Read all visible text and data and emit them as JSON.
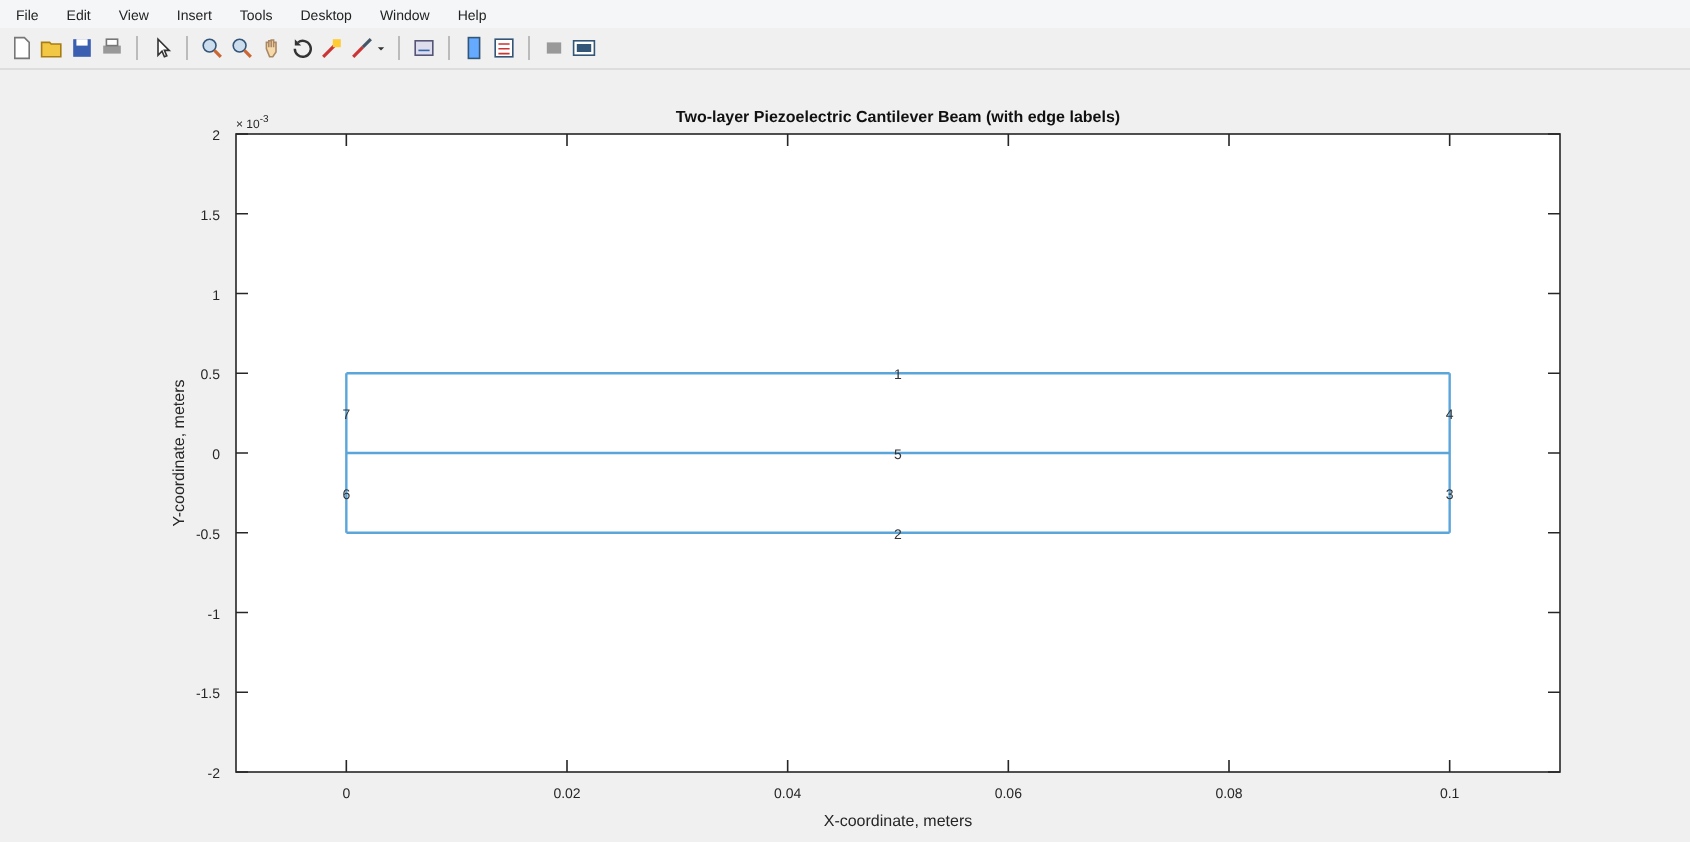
{
  "menu": [
    "File",
    "Edit",
    "View",
    "Insert",
    "Tools",
    "Desktop",
    "Window",
    "Help"
  ],
  "axes": {
    "y_exponent": "× 10$^{-3}$",
    "chart_data": {
      "type": "line",
      "title": "Two-layer Piezoelectric Cantilever Beam (with edge labels)",
      "xlabel": "X-coordinate, meters",
      "ylabel": "Y-coordinate, meters",
      "xlim": [
        -0.01,
        0.11
      ],
      "ylim": [
        -2,
        2
      ],
      "xticks": [
        0,
        0.02,
        0.04,
        0.06,
        0.08,
        0.1
      ],
      "yticks": [
        -2,
        -1.5,
        -1,
        -0.5,
        0,
        0.5,
        1,
        1.5,
        2
      ],
      "x": [
        0,
        0.05,
        0.1
      ],
      "series": [
        {
          "color": "#5aa5da",
          "values": [
            0.5,
            0.5,
            0.5
          ]
        },
        {
          "color": "#5aa5da",
          "values": [
            0,
            0,
            0
          ]
        },
        {
          "color": "#5aa5da",
          "values": [
            -0.5,
            -0.5,
            -0.5
          ]
        }
      ]
    },
    "edge_labels": [
      {
        "text": "1",
        "kind": "top"
      },
      {
        "text": "2",
        "kind": "bottom"
      },
      {
        "text": "3",
        "kind": "right-lower"
      },
      {
        "text": "4",
        "kind": "right-upper"
      },
      {
        "text": "5",
        "kind": "middle"
      },
      {
        "text": "6",
        "kind": "left-lower"
      },
      {
        "text": "7",
        "kind": "left-upper"
      }
    ]
  }
}
